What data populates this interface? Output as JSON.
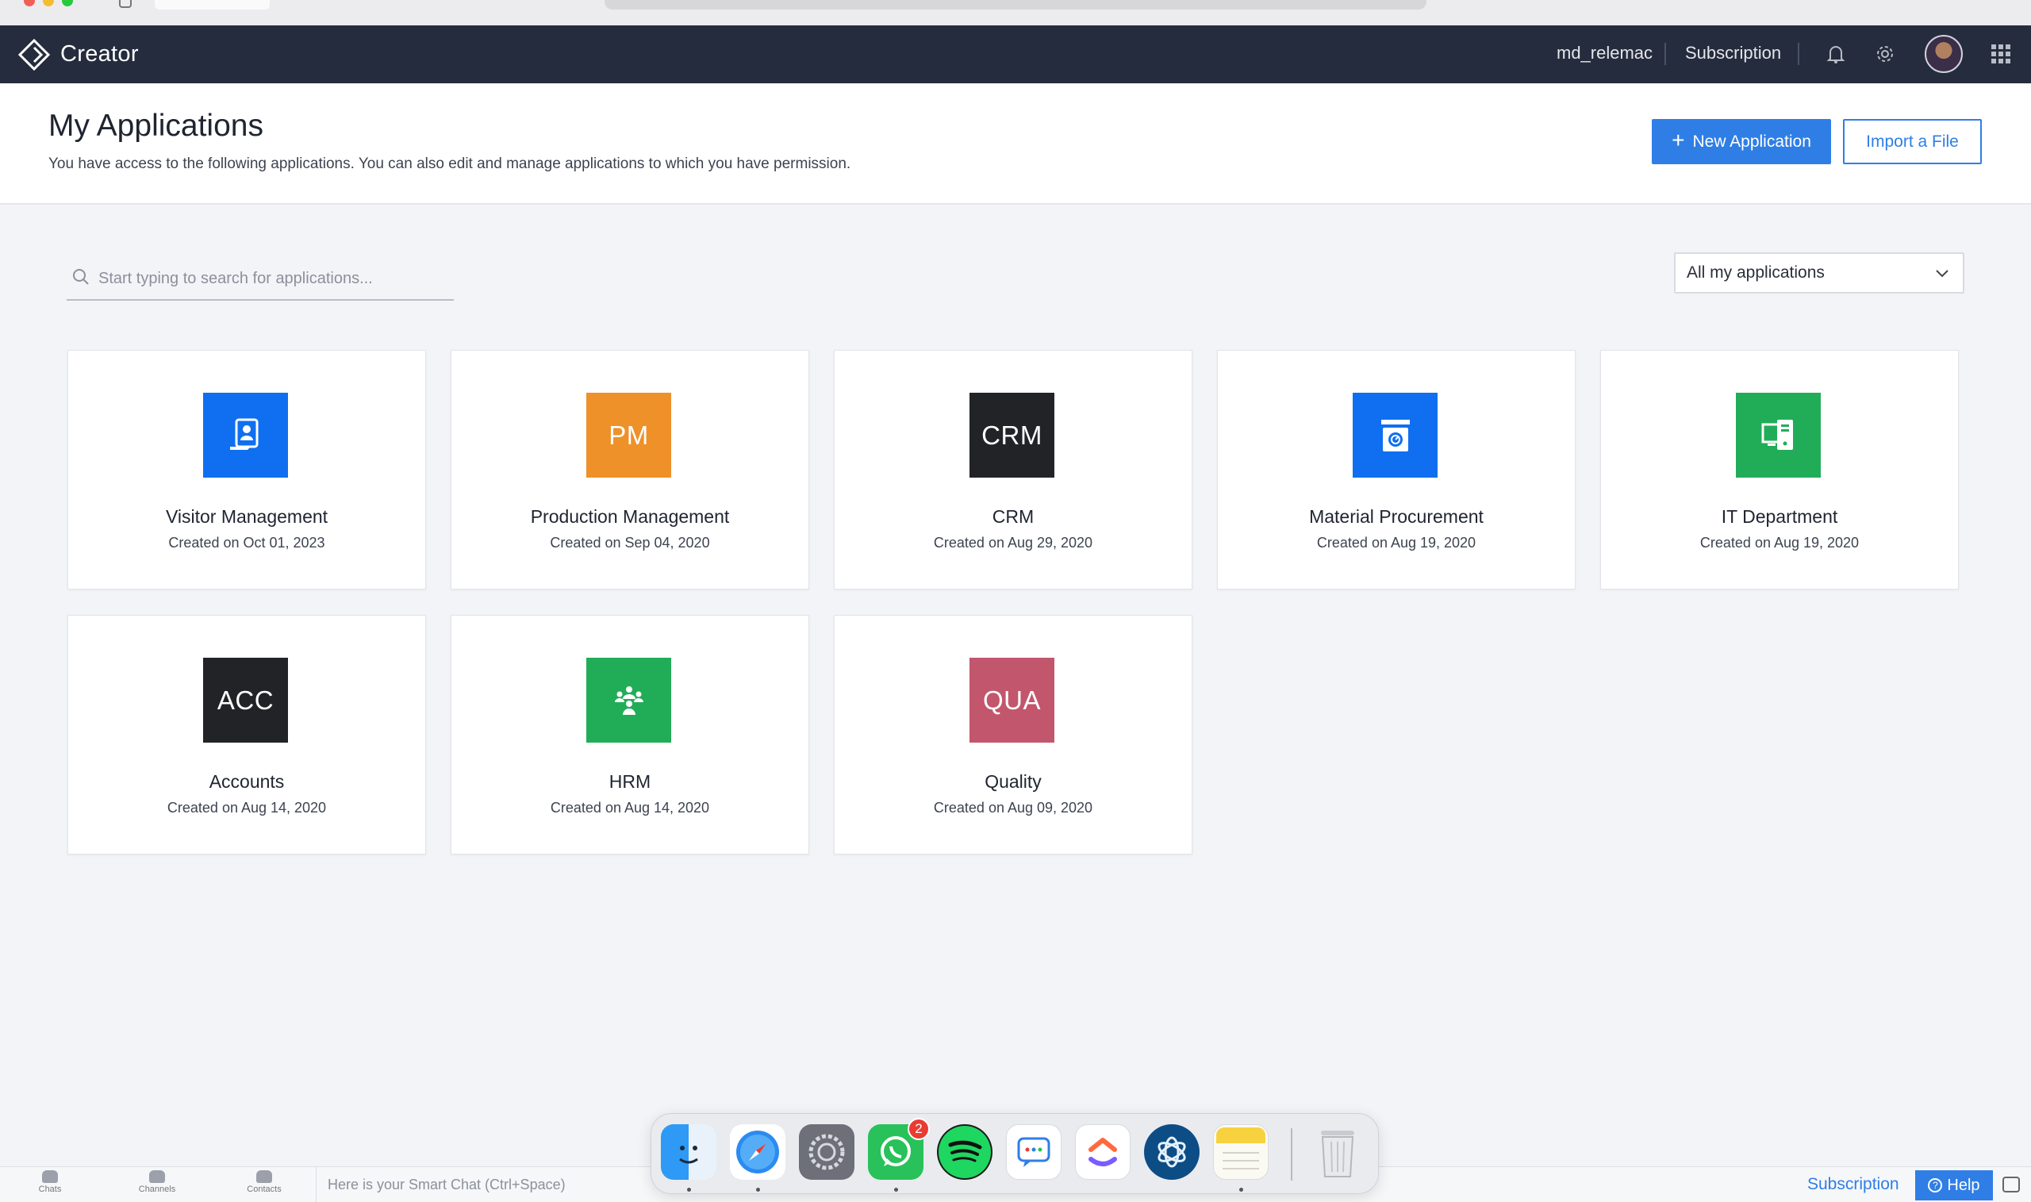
{
  "topnav": {
    "brand": "Creator",
    "username": "md_relemac",
    "subscription": "Subscription"
  },
  "header": {
    "title": "My Applications",
    "subtitle": "You have access to the following applications. You can also edit and manage applications to which you have permission.",
    "new_app_label": "New Application",
    "import_label": "Import a File"
  },
  "search": {
    "placeholder": "Start typing to search for applications..."
  },
  "filter": {
    "selected": "All my applications"
  },
  "apps": [
    {
      "name": "Visitor Management",
      "created": "Created on Oct 01, 2023",
      "icon_text": "",
      "icon_name": "visitor-badge-icon",
      "color": "#0f6ff0"
    },
    {
      "name": "Production Management",
      "created": "Created on Sep 04, 2020",
      "icon_text": "PM",
      "icon_name": "",
      "color": "#ee9128"
    },
    {
      "name": "CRM",
      "created": "Created on Aug 29, 2020",
      "icon_text": "CRM",
      "icon_name": "",
      "color": "#222326"
    },
    {
      "name": "Material Procurement",
      "created": "Created on Aug 19, 2020",
      "icon_text": "",
      "icon_name": "scale-icon",
      "color": "#0f6ff0"
    },
    {
      "name": "IT Department",
      "created": "Created on Aug 19, 2020",
      "icon_text": "",
      "icon_name": "devices-icon",
      "color": "#21ad58"
    },
    {
      "name": "Accounts",
      "created": "Created on Aug 14, 2020",
      "icon_text": "ACC",
      "icon_name": "",
      "color": "#222326"
    },
    {
      "name": "HRM",
      "created": "Created on Aug 14, 2020",
      "icon_text": "",
      "icon_name": "people-group-icon",
      "color": "#21ad58"
    },
    {
      "name": "Quality",
      "created": "Created on Aug 09, 2020",
      "icon_text": "QUA",
      "icon_name": "",
      "color": "#c2566d"
    }
  ],
  "bottom_bar": {
    "tabs": [
      "Chats",
      "Channels",
      "Contacts"
    ],
    "smart_chat_placeholder": "Here is your Smart Chat (Ctrl+Space)",
    "subscription": "Subscription",
    "help": "Help"
  },
  "dock": {
    "whatsapp_badge": "2",
    "apps": [
      "finder-icon",
      "safari-icon",
      "system-settings-icon",
      "whatsapp-icon",
      "spotify-icon",
      "messages-app-icon",
      "clickup-icon",
      "perplexity-icon",
      "notes-icon",
      "trash-icon"
    ]
  }
}
